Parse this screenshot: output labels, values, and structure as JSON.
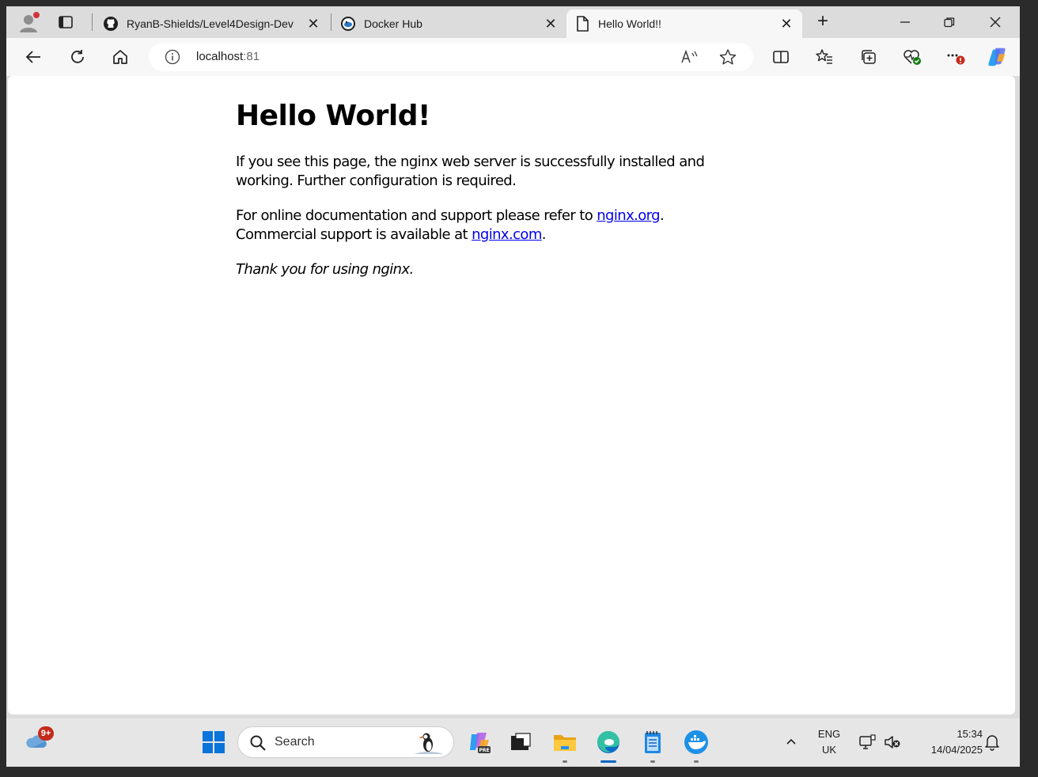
{
  "browser": {
    "tabs": [
      {
        "title": "RyanB-Shields/Level4Design-Dev",
        "icon": "github-icon",
        "close": "✕"
      },
      {
        "title": "Docker Hub",
        "icon": "docker-hub-icon",
        "close": "✕"
      },
      {
        "title": "Hello World!!",
        "icon": "page-icon",
        "close": "✕"
      }
    ],
    "new_tab": "+",
    "address": {
      "host": "localhost",
      "port": ":81"
    }
  },
  "page": {
    "heading": "Hello World!",
    "para1": "If you see this page, the nginx web server is successfully installed and working. Further configuration is required.",
    "para2_prefix": "For online documentation and support please refer to ",
    "link_org": "nginx.org",
    "para2_mid": ". Commercial support is available at ",
    "link_com": "nginx.com",
    "para2_end": ".",
    "thanks": "Thank you for using nginx."
  },
  "taskbar": {
    "weather_badge": "9+",
    "search_label": "Search",
    "lang": "ENG",
    "region": "UK",
    "time": "15:34",
    "date": "14/04/2025"
  },
  "colors": {
    "accent": "#0067c0",
    "link": "#0000ee",
    "badge": "#c42b1c"
  }
}
